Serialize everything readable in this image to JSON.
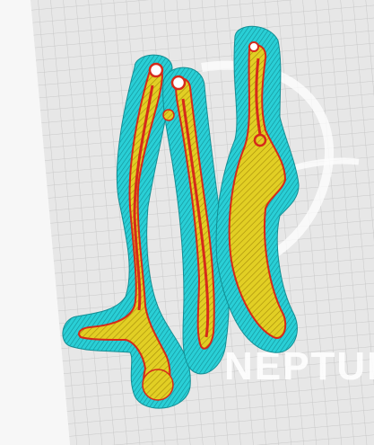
{
  "viewport": {
    "bed_logo_text": "NEPTUNE",
    "colors": {
      "background": "#f7f7f7",
      "bed": "#e6e6e6",
      "grid": "#c9c9c9",
      "skirt": "#23c8cf",
      "skirt_line": "#138e94",
      "infill": "#d6c21a",
      "infill_line": "#b39a10",
      "outer_wall": "#d62a1a"
    },
    "parts": [
      "left-arm-part",
      "right-arm-part",
      "blade-part"
    ],
    "icons": [
      "hole-icon"
    ]
  }
}
